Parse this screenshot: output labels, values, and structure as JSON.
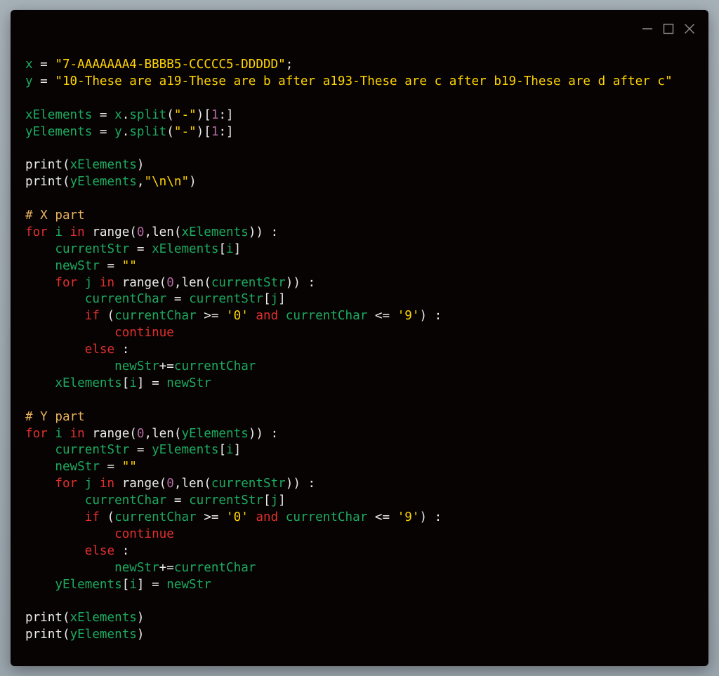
{
  "window": {
    "controls": [
      {
        "name": "minimize-icon"
      },
      {
        "name": "maximize-icon"
      },
      {
        "name": "close-icon"
      }
    ]
  },
  "colors": {
    "background": "#070303",
    "keyword": "#e0302d",
    "identifier": "#1cab5f",
    "string": "#ffd500",
    "number": "#b16ba0",
    "plain": "#ececec",
    "comment": "#e8b25c"
  },
  "code": {
    "lines": [
      [
        [
          "v",
          "x"
        ],
        [
          "p",
          " = "
        ],
        [
          "s",
          "\"7-AAAAAAA4-BBBB5-CCCCC5-DDDDD\""
        ],
        [
          "p",
          ";"
        ]
      ],
      [
        [
          "v",
          "y"
        ],
        [
          "p",
          " = "
        ],
        [
          "s",
          "\"10-These are a19-These are b after a193-These are c after b19-These are d after c\""
        ]
      ],
      [],
      [
        [
          "v",
          "xElements"
        ],
        [
          "p",
          " = "
        ],
        [
          "v",
          "x"
        ],
        [
          "p",
          "."
        ],
        [
          "v",
          "split"
        ],
        [
          "p",
          "("
        ],
        [
          "s",
          "\"-\""
        ],
        [
          "p",
          ")["
        ],
        [
          "n",
          "1"
        ],
        [
          "p",
          ":]"
        ]
      ],
      [
        [
          "v",
          "yElements"
        ],
        [
          "p",
          " = "
        ],
        [
          "v",
          "y"
        ],
        [
          "p",
          "."
        ],
        [
          "v",
          "split"
        ],
        [
          "p",
          "("
        ],
        [
          "s",
          "\"-\""
        ],
        [
          "p",
          ")["
        ],
        [
          "n",
          "1"
        ],
        [
          "p",
          ":]"
        ]
      ],
      [],
      [
        [
          "p",
          "print("
        ],
        [
          "v",
          "xElements"
        ],
        [
          "p",
          ")"
        ]
      ],
      [
        [
          "p",
          "print("
        ],
        [
          "v",
          "yElements"
        ],
        [
          "p",
          ","
        ],
        [
          "s",
          "\"\\n\\n\""
        ],
        [
          "p",
          ")"
        ]
      ],
      [],
      [
        [
          "c",
          "# X part"
        ]
      ],
      [
        [
          "k",
          "for "
        ],
        [
          "v",
          "i"
        ],
        [
          "k",
          " in "
        ],
        [
          "p",
          "range("
        ],
        [
          "n",
          "0"
        ],
        [
          "p",
          ",len("
        ],
        [
          "v",
          "xElements"
        ],
        [
          "p",
          ")) :"
        ]
      ],
      [
        [
          "p",
          "    "
        ],
        [
          "v",
          "currentStr"
        ],
        [
          "p",
          " = "
        ],
        [
          "v",
          "xElements"
        ],
        [
          "p",
          "["
        ],
        [
          "v",
          "i"
        ],
        [
          "p",
          "]"
        ]
      ],
      [
        [
          "p",
          "    "
        ],
        [
          "v",
          "newStr"
        ],
        [
          "p",
          " = "
        ],
        [
          "s",
          "\"\""
        ]
      ],
      [
        [
          "p",
          "    "
        ],
        [
          "k",
          "for "
        ],
        [
          "v",
          "j"
        ],
        [
          "k",
          " in "
        ],
        [
          "p",
          "range("
        ],
        [
          "n",
          "0"
        ],
        [
          "p",
          ",len("
        ],
        [
          "v",
          "currentStr"
        ],
        [
          "p",
          ")) :"
        ]
      ],
      [
        [
          "p",
          "        "
        ],
        [
          "v",
          "currentChar"
        ],
        [
          "p",
          " = "
        ],
        [
          "v",
          "currentStr"
        ],
        [
          "p",
          "["
        ],
        [
          "v",
          "j"
        ],
        [
          "p",
          "]"
        ]
      ],
      [
        [
          "p",
          "        "
        ],
        [
          "k",
          "if"
        ],
        [
          "p",
          " ("
        ],
        [
          "v",
          "currentChar"
        ],
        [
          "p",
          " >= "
        ],
        [
          "s",
          "'0'"
        ],
        [
          "k",
          " and "
        ],
        [
          "v",
          "currentChar"
        ],
        [
          "p",
          " <= "
        ],
        [
          "s",
          "'9'"
        ],
        [
          "p",
          ") :"
        ]
      ],
      [
        [
          "p",
          "            "
        ],
        [
          "k",
          "continue"
        ]
      ],
      [
        [
          "p",
          "        "
        ],
        [
          "k",
          "else"
        ],
        [
          "p",
          " :"
        ]
      ],
      [
        [
          "p",
          "            "
        ],
        [
          "v",
          "newStr"
        ],
        [
          "p",
          "+="
        ],
        [
          "v",
          "currentChar"
        ]
      ],
      [
        [
          "p",
          "    "
        ],
        [
          "v",
          "xElements"
        ],
        [
          "p",
          "["
        ],
        [
          "v",
          "i"
        ],
        [
          "p",
          "] = "
        ],
        [
          "v",
          "newStr"
        ]
      ],
      [],
      [
        [
          "c",
          "# Y part"
        ]
      ],
      [
        [
          "k",
          "for "
        ],
        [
          "v",
          "i"
        ],
        [
          "k",
          " in "
        ],
        [
          "p",
          "range("
        ],
        [
          "n",
          "0"
        ],
        [
          "p",
          ",len("
        ],
        [
          "v",
          "yElements"
        ],
        [
          "p",
          ")) :"
        ]
      ],
      [
        [
          "p",
          "    "
        ],
        [
          "v",
          "currentStr"
        ],
        [
          "p",
          " = "
        ],
        [
          "v",
          "yElements"
        ],
        [
          "p",
          "["
        ],
        [
          "v",
          "i"
        ],
        [
          "p",
          "]"
        ]
      ],
      [
        [
          "p",
          "    "
        ],
        [
          "v",
          "newStr"
        ],
        [
          "p",
          " = "
        ],
        [
          "s",
          "\"\""
        ]
      ],
      [
        [
          "p",
          "    "
        ],
        [
          "k",
          "for "
        ],
        [
          "v",
          "j"
        ],
        [
          "k",
          " in "
        ],
        [
          "p",
          "range("
        ],
        [
          "n",
          "0"
        ],
        [
          "p",
          ",len("
        ],
        [
          "v",
          "currentStr"
        ],
        [
          "p",
          ")) :"
        ]
      ],
      [
        [
          "p",
          "        "
        ],
        [
          "v",
          "currentChar"
        ],
        [
          "p",
          " = "
        ],
        [
          "v",
          "currentStr"
        ],
        [
          "p",
          "["
        ],
        [
          "v",
          "j"
        ],
        [
          "p",
          "]"
        ]
      ],
      [
        [
          "p",
          "        "
        ],
        [
          "k",
          "if"
        ],
        [
          "p",
          " ("
        ],
        [
          "v",
          "currentChar"
        ],
        [
          "p",
          " >= "
        ],
        [
          "s",
          "'0'"
        ],
        [
          "k",
          " and "
        ],
        [
          "v",
          "currentChar"
        ],
        [
          "p",
          " <= "
        ],
        [
          "s",
          "'9'"
        ],
        [
          "p",
          ") :"
        ]
      ],
      [
        [
          "p",
          "            "
        ],
        [
          "k",
          "continue"
        ]
      ],
      [
        [
          "p",
          "        "
        ],
        [
          "k",
          "else"
        ],
        [
          "p",
          " :"
        ]
      ],
      [
        [
          "p",
          "            "
        ],
        [
          "v",
          "newStr"
        ],
        [
          "p",
          "+="
        ],
        [
          "v",
          "currentChar"
        ]
      ],
      [
        [
          "p",
          "    "
        ],
        [
          "v",
          "yElements"
        ],
        [
          "p",
          "["
        ],
        [
          "v",
          "i"
        ],
        [
          "p",
          "] = "
        ],
        [
          "v",
          "newStr"
        ]
      ],
      [],
      [
        [
          "p",
          "print("
        ],
        [
          "v",
          "xElements"
        ],
        [
          "p",
          ")"
        ]
      ],
      [
        [
          "p",
          "print("
        ],
        [
          "v",
          "yElements"
        ],
        [
          "p",
          ")"
        ]
      ]
    ]
  }
}
